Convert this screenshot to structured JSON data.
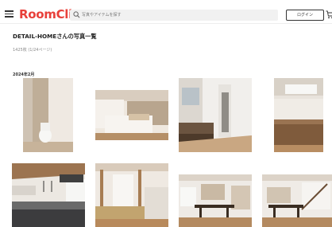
{
  "header": {
    "logo": "RoomClip",
    "search_placeholder": "写真やアイテムを探す",
    "login_label": "ログイン"
  },
  "page": {
    "title": "DETAIL-HOMEさんの写真一覧",
    "count": "1425枚 (1/24ページ)",
    "month": "2024年2月"
  },
  "photos": [
    {
      "subject": "toilet room"
    },
    {
      "subject": "bedroom"
    },
    {
      "subject": "washroom"
    },
    {
      "subject": "wooden counter"
    },
    {
      "subject": "kitchen"
    },
    {
      "subject": "tatami room"
    },
    {
      "subject": "dining"
    },
    {
      "subject": "living dining"
    }
  ],
  "colors": {
    "brand": "#e8403a",
    "text": "#222222",
    "muted": "#888888"
  }
}
